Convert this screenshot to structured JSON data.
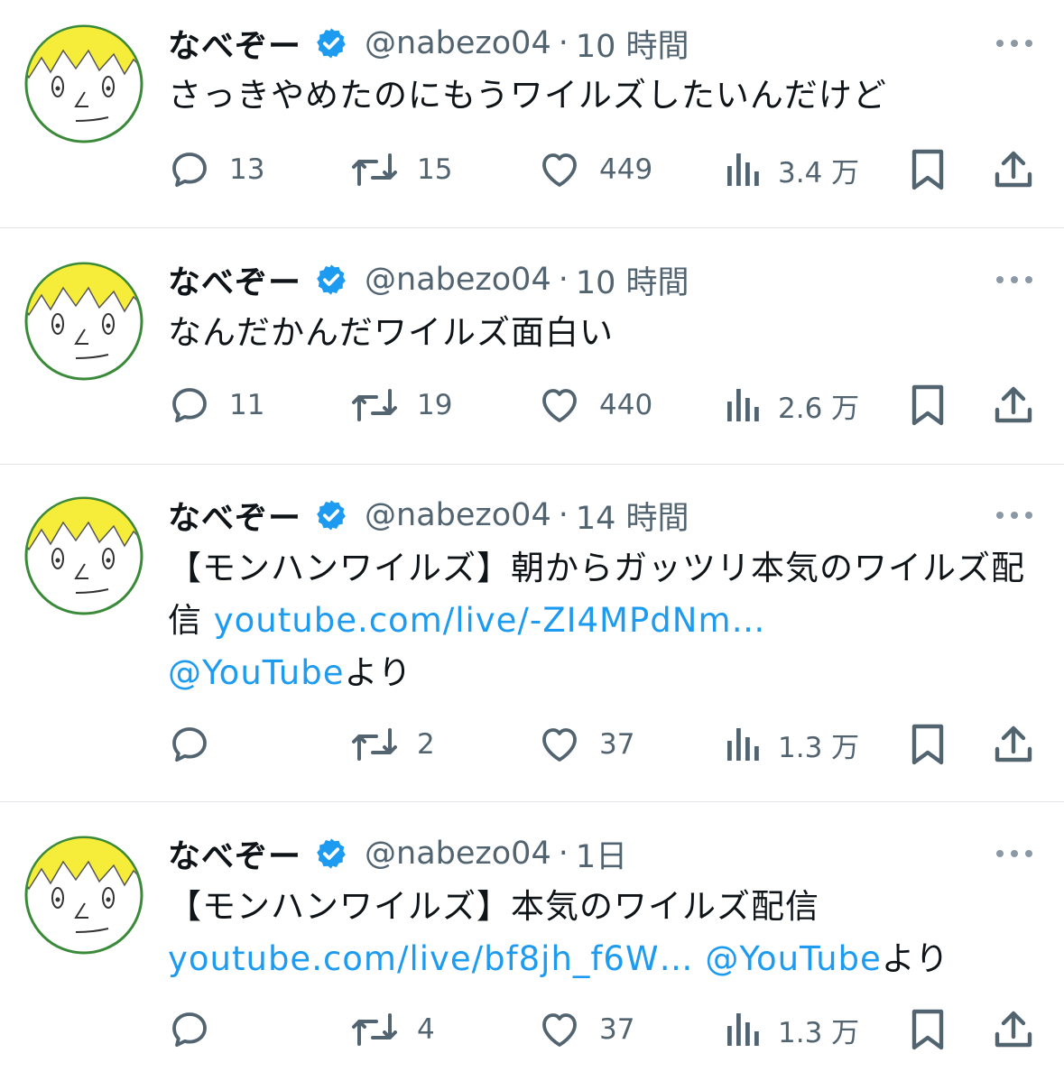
{
  "tweets": [
    {
      "display_name": "なべぞー",
      "handle": "@nabezo04",
      "separator": "·",
      "time": "10 時間",
      "text_parts": [
        "さっきやめたのにもうワイルズしたいんだけど"
      ],
      "replies": "13",
      "retweets": "15",
      "likes": "449",
      "views": "3.4 万"
    },
    {
      "display_name": "なべぞー",
      "handle": "@nabezo04",
      "separator": "·",
      "time": "10 時間",
      "text_parts": [
        "なんだかんだワイルズ面白い"
      ],
      "replies": "11",
      "retweets": "19",
      "likes": "440",
      "views": "2.6 万"
    },
    {
      "display_name": "なべぞー",
      "handle": "@nabezo04",
      "separator": "·",
      "time": "14 時間",
      "text_parts": [
        "【モンハンワイルズ】朝からガッツリ本気のワイルズ配信 ",
        "youtube.com/live/-ZI4MPdNm…",
        "@YouTube",
        "より"
      ],
      "replies": "",
      "retweets": "2",
      "likes": "37",
      "views": "1.3 万"
    },
    {
      "display_name": "なべぞー",
      "handle": "@nabezo04",
      "separator": "·",
      "time": "1日",
      "text_parts": [
        "【モンハンワイルズ】本気のワイルズ配信",
        "youtube.com/live/bf8jh_f6W…",
        " ",
        "@YouTube",
        "より"
      ],
      "replies": "",
      "retweets": "4",
      "likes": "37",
      "views": "1.3 万"
    }
  ],
  "icons": {
    "verified": "verified-badge-icon",
    "more": "more-dots-icon",
    "reply": "reply-bubble-icon",
    "retweet": "retweet-arrows-icon",
    "like": "heart-icon",
    "views": "bar-chart-icon",
    "bookmark": "bookmark-icon",
    "share": "share-upload-icon"
  },
  "colors": {
    "text": "#0f1419",
    "secondary": "#536471",
    "link": "#1d9bf0",
    "verified": "#1d9bf0",
    "avatar_hair": "#f6ec3a",
    "avatar_ring": "#3a8a3a",
    "divider": "#e1e4e8"
  }
}
